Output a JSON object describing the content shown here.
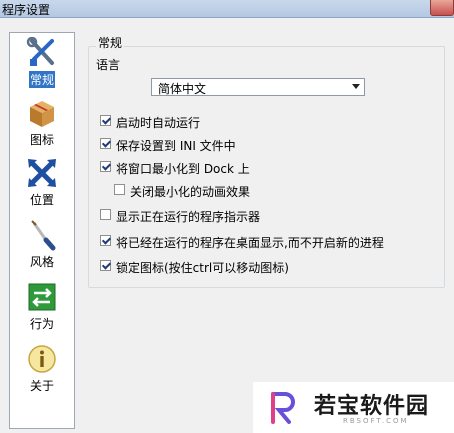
{
  "window": {
    "title": "程序设置"
  },
  "sidebar": {
    "items": [
      {
        "label": "常规",
        "icon": "tools-icon",
        "active": true
      },
      {
        "label": "图标",
        "icon": "package-icon",
        "active": false
      },
      {
        "label": "位置",
        "icon": "move-icon",
        "active": false
      },
      {
        "label": "风格",
        "icon": "paintbrush-icon",
        "active": false
      },
      {
        "label": "行为",
        "icon": "arrows-icon",
        "active": false
      },
      {
        "label": "关于",
        "icon": "info-icon",
        "active": false
      }
    ]
  },
  "general": {
    "section_title": "常规",
    "language_label": "语言",
    "language_value": "简体中文",
    "options": [
      {
        "label": "启动时自动运行",
        "checked": true
      },
      {
        "label": "保存设置到 INI 文件中",
        "checked": true
      },
      {
        "label": "将窗口最小化到 Dock 上",
        "checked": true
      },
      {
        "label": "关闭最小化的动画效果",
        "checked": false
      },
      {
        "label": "显示正在运行的程序指示器",
        "checked": false
      },
      {
        "label": "将已经在运行的程序在桌面显示,而不开启新的进程",
        "checked": true
      },
      {
        "label": "锁定图标(按住ctrl可以移动图标)",
        "checked": true
      }
    ]
  },
  "watermark": {
    "text": "若宝软件园",
    "subtext": "RBSOFT.COM"
  },
  "colors": {
    "accent": "#3175c8",
    "titlebar": "#b4c8e2"
  }
}
